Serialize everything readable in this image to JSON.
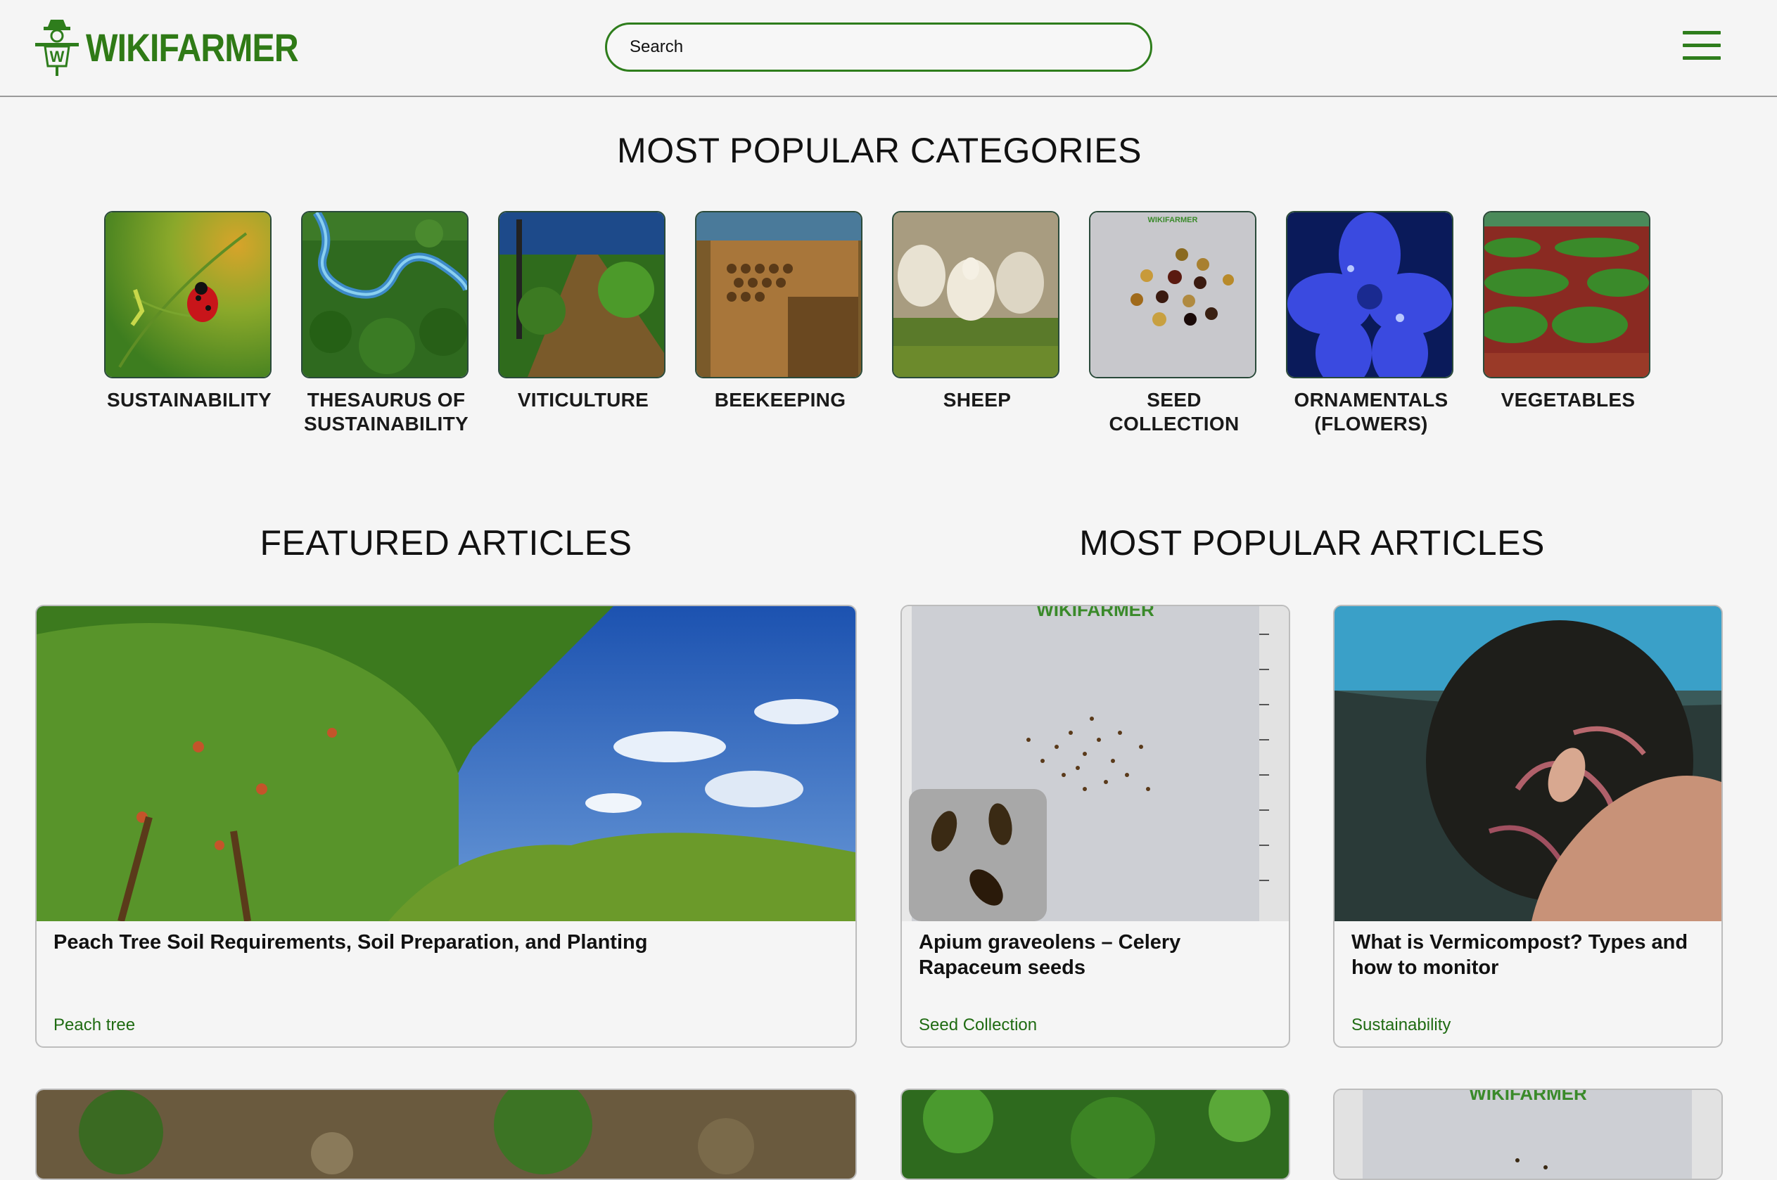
{
  "header": {
    "logo_text": "WIKIFARMER",
    "logo_mark": "W",
    "search_placeholder": "Search",
    "brand_color": "#2e7d1c"
  },
  "categories": {
    "title": "MOST POPULAR CATEGORIES",
    "items": [
      {
        "line1": "SUSTAINABILITY",
        "line2": ""
      },
      {
        "line1": "THESAURUS OF",
        "line2": "SUSTAINABILITY"
      },
      {
        "line1": "VITICULTURE",
        "line2": ""
      },
      {
        "line1": "BEEKEEPING",
        "line2": ""
      },
      {
        "line1": "SHEEP",
        "line2": ""
      },
      {
        "line1": "SEED COLLECTION",
        "line2": ""
      },
      {
        "line1": "ORNAMENTALS",
        "line2": "(FLOWERS)"
      },
      {
        "line1": "VEGETABLES",
        "line2": ""
      }
    ],
    "seed_watermark": "WIKIFARMER"
  },
  "featured": {
    "title": "FEATURED ARTICLES",
    "articles": [
      {
        "title": "Peach Tree Soil Requirements, Soil Preparation, and Planting",
        "tag": "Peach tree"
      }
    ]
  },
  "popular": {
    "title": "MOST POPULAR ARTICLES",
    "articles": [
      {
        "title": "Apium graveolens – Celery Rapaceum seeds",
        "tag": "Seed Collection",
        "watermark": "WIKIFARMER"
      },
      {
        "title": "What is Vermicompost? Types and how to monitor",
        "tag": "Sustainability"
      }
    ],
    "second_row_watermark": "WIKIFARMER"
  }
}
